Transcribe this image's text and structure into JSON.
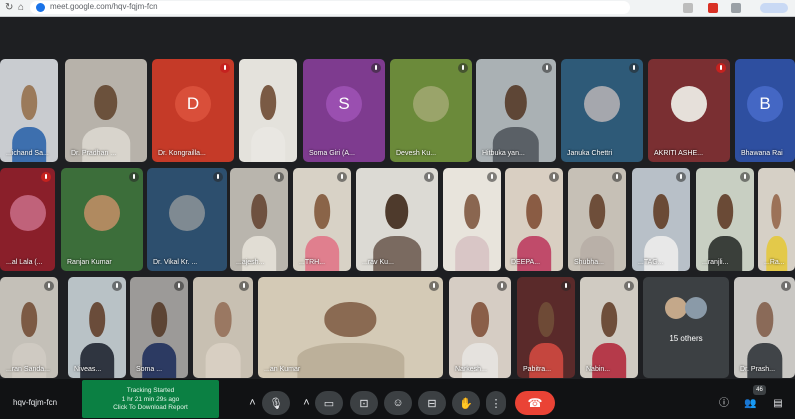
{
  "browser": {
    "url": "meet.google.com/hqv-fqjm-fcn"
  },
  "tiles": [
    {
      "name": "...ichand Sa...",
      "type": "video",
      "bg": "#c9ccd0",
      "skin": "#9b7a5a",
      "shirt": "#3d6fae"
    },
    {
      "name": "Dr. Pradhan ...",
      "type": "video",
      "bg": "#b7b2aa",
      "skin": "#6b513c",
      "shirt": "#d8d4cc"
    },
    {
      "name": "Dr. Kongrailla...",
      "type": "avatar",
      "bg": "#c53a28",
      "letter": "D",
      "avatar_color": "#d94f3a",
      "mic": "red"
    },
    {
      "name": "",
      "type": "video",
      "bg": "#e4e2dc",
      "skin": "#7a5a44",
      "shirt": "#e9e7e2"
    },
    {
      "name": "Soma Giri (A...",
      "type": "avatar",
      "bg": "#7e3b8f",
      "letter": "S",
      "avatar_color": "#9a4fb0",
      "mic": "dark"
    },
    {
      "name": "Devesh Ku...",
      "type": "photo",
      "bg": "#6b8a3a",
      "photo": "#9aa46a",
      "mic": "dark"
    },
    {
      "name": "Hitbuka yan...",
      "type": "video",
      "bg": "#aab1b4",
      "skin": "#5e4636",
      "shirt": "#5a6066",
      "mic": "dark"
    },
    {
      "name": "Januka Chettri",
      "type": "photo",
      "bg": "#2e5a78",
      "photo": "#a5a7ad",
      "mic": "dark"
    },
    {
      "name": "AKRITI ASHE...",
      "type": "photo",
      "bg": "#7a2f32",
      "photo": "#e6e0da",
      "mic": "red"
    },
    {
      "name": "Bhawana Rai",
      "type": "avatar",
      "bg": "#2e4fa0",
      "letter": "B",
      "avatar_color": "#4467c4"
    },
    {
      "name": "...al Lala (...",
      "type": "photo",
      "bg": "#8a1f2a",
      "photo": "#c0627a",
      "mic": "red"
    },
    {
      "name": "Ranjan Kumar",
      "type": "photo",
      "bg": "#3c6e3a",
      "photo": "#b08a60",
      "mic": "dark"
    },
    {
      "name": "Dr. Vikal Kr. ...",
      "type": "photo",
      "bg": "#2d4f6e",
      "photo": "#7f8a92",
      "mic": "dark"
    },
    {
      "name": "...ajesh...",
      "type": "video",
      "bg": "#b9b5ad",
      "skin": "#6e5140",
      "shirt": "#e1ddd4",
      "mic": "dark"
    },
    {
      "name": "...TRH...",
      "type": "video",
      "bg": "#d8d2c6",
      "skin": "#8a6448",
      "shirt": "#e07f8e",
      "mic": "dark"
    },
    {
      "name": "...rav Ku...",
      "type": "video",
      "bg": "#dcdad4",
      "skin": "#4e3a2c",
      "shirt": "#7a6a60",
      "mic": "dark"
    },
    {
      "name": "",
      "type": "video",
      "bg": "#e8e4dc",
      "skin": "#8a6650",
      "shirt": "#d9c6c6",
      "mic": "dark"
    },
    {
      "name": "DEEPA...",
      "type": "video",
      "bg": "#d9cfc2",
      "skin": "#8a5c44",
      "shirt": "#c04b6a",
      "mic": "dark"
    },
    {
      "name": "Shubha...",
      "type": "video",
      "bg": "#c6c0b6",
      "skin": "#6e4e3a",
      "shirt": "#b9b0a8",
      "mic": "dark"
    },
    {
      "name": "...TAG...",
      "type": "video",
      "bg": "#b8c0c8",
      "skin": "#6a4a36",
      "shirt": "#e8e8e8",
      "mic": "dark"
    },
    {
      "name": "...ranjli...",
      "type": "video",
      "bg": "#c8cfc2",
      "skin": "#6a4a36",
      "shirt": "#3a3f3a",
      "mic": "dark"
    },
    {
      "name": "...Ra...",
      "type": "video",
      "bg": "#d6d0c6",
      "skin": "#9c7258",
      "shirt": "#e3c94a"
    },
    {
      "name": "...ran Sanda...",
      "type": "video",
      "bg": "#c4c0b8",
      "skin": "#7c5a44",
      "shirt": "#cfcac2",
      "mic": "dark"
    },
    {
      "name": "Niveas...",
      "type": "video",
      "bg": "#b9c2c6",
      "skin": "#6a4c3a",
      "shirt": "#2f3540",
      "mic": "dark"
    },
    {
      "name": "Soma ...",
      "type": "video",
      "bg": "#9c9a98",
      "skin": "#5c4434",
      "shirt": "#2c3a62",
      "mic": "dark"
    },
    {
      "name": "",
      "type": "video",
      "bg": "#c8c0b2",
      "skin": "#9a7862",
      "shirt": "#d8cfc2",
      "mic": "dark"
    },
    {
      "name": "...an Kumar",
      "type": "video",
      "bg": "#d4cab6",
      "skin": "#8a6a52",
      "shirt": "#bcb09a",
      "mic": "dark"
    },
    {
      "name": "Narkesh...",
      "type": "video",
      "bg": "#d6cdc4",
      "skin": "#8a5e48",
      "shirt": "#e5e2de",
      "mic": "dark"
    },
    {
      "name": "Pabitra...",
      "type": "video",
      "bg": "#5a2a2a",
      "skin": "#6e4a36",
      "shirt": "#c5463e",
      "mic": "dark"
    },
    {
      "name": "Nabin...",
      "type": "video",
      "bg": "#d0cbc2",
      "skin": "#6e4e3a",
      "shirt": "#b53a4a",
      "mic": "dark"
    },
    {
      "name": "Dr. Prash...",
      "type": "video",
      "bg": "#c9c7c3",
      "skin": "#8a6a58",
      "shirt": "#404448",
      "mic": "dark"
    }
  ],
  "others": {
    "label": "15 others",
    "mini1": "#c4a88a",
    "mini2": "#8a9aa8"
  },
  "bottom": {
    "meeting_id": "hqv-fqjm-fcn",
    "notification": {
      "line1": "Tracking Started",
      "line2": "1 hr 21 min 29s ago",
      "line3": "Click To Download Report",
      "color": "#0b8043"
    },
    "controls": [
      "chevron-up-icon",
      "mic-icon",
      "chevron-up-icon",
      "camera-icon",
      "captions-icon",
      "emoji-icon",
      "present-icon",
      "raise-hand-icon",
      "more-vert-icon",
      "hang-up-icon"
    ],
    "right_badge": "46"
  }
}
